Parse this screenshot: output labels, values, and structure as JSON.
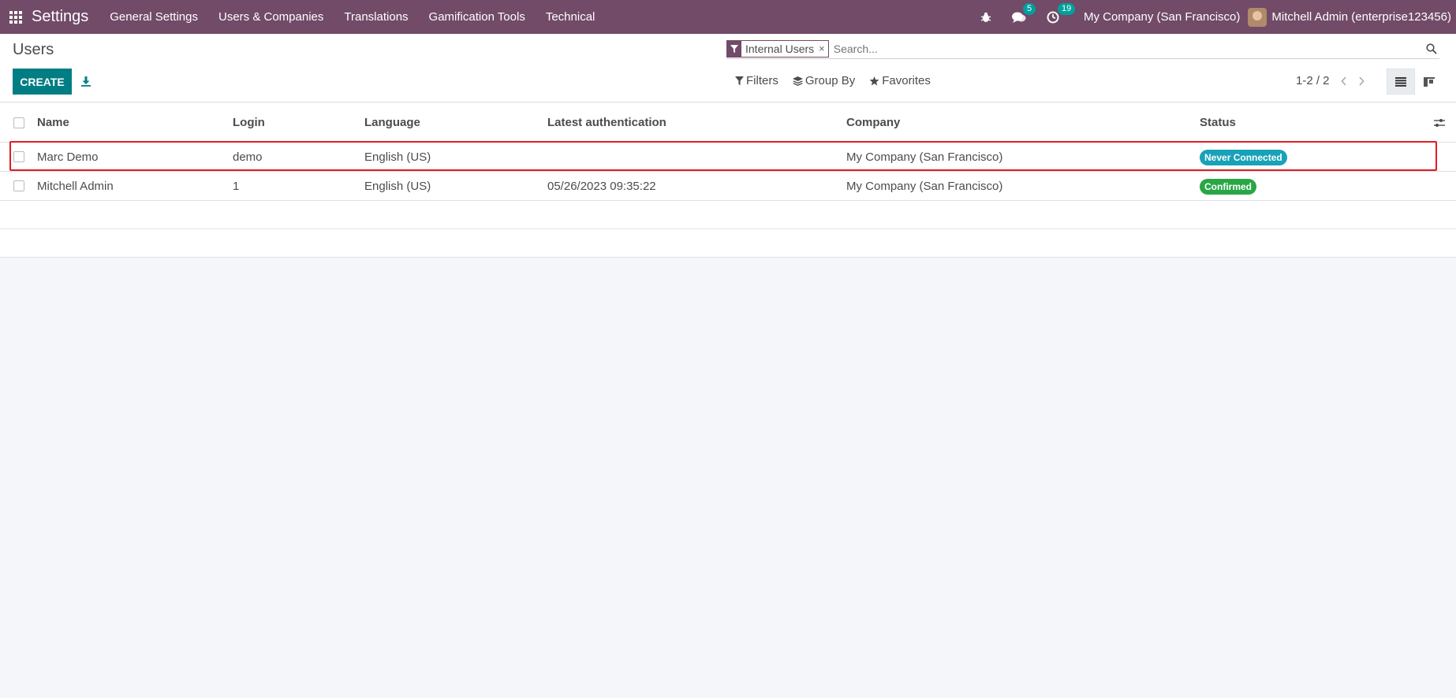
{
  "navbar": {
    "app_name": "Settings",
    "menu": [
      "General Settings",
      "Users & Companies",
      "Translations",
      "Gamification Tools",
      "Technical"
    ],
    "messages_count": "5",
    "activities_count": "19",
    "company": "My Company (San Francisco)",
    "user": "Mitchell Admin (enterprise123456)"
  },
  "control_panel": {
    "title": "Users",
    "create_label": "CREATE",
    "facet_label": "Internal Users",
    "facet_close": "×",
    "search_placeholder": "Search...",
    "filters_label": "Filters",
    "group_by_label": "Group By",
    "favorites_label": "Favorites",
    "pager": "1-2 / 2"
  },
  "table": {
    "columns": [
      "Name",
      "Login",
      "Language",
      "Latest authentication",
      "Company",
      "Status"
    ],
    "rows": [
      {
        "name": "Marc Demo",
        "login": "demo",
        "language": "English (US)",
        "latest_auth": "",
        "company": "My Company (San Francisco)",
        "status": "Never Connected",
        "status_color": "#17a2b8"
      },
      {
        "name": "Mitchell Admin",
        "login": "1",
        "language": "English (US)",
        "latest_auth": "05/26/2023 09:35:22",
        "company": "My Company (San Francisco)",
        "status": "Confirmed",
        "status_color": "#28a745"
      }
    ]
  },
  "colors": {
    "brand": "#714b67",
    "primary_button": "#017e84",
    "highlight_border": "#e01b24"
  }
}
